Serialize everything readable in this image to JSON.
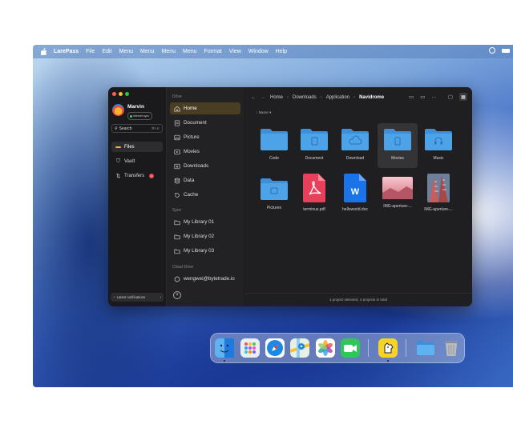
{
  "menubar": {
    "app": "LarePass",
    "items": [
      "File",
      "Edit",
      "Menu",
      "Menu",
      "Menu",
      "Menu",
      "Format",
      "View",
      "Window",
      "Help"
    ]
  },
  "user": {
    "name": "Marvin",
    "status": "Internet sync"
  },
  "search": {
    "placeholder": "Search",
    "shortcut": "⌘+K"
  },
  "sidebar_main": [
    {
      "label": "Files",
      "icon": "folder-icon",
      "active": true
    },
    {
      "label": "Vault",
      "icon": "shield-icon"
    },
    {
      "label": "Transfers",
      "icon": "transfer-icon",
      "badge": "1"
    }
  ],
  "notifications": {
    "label": "Latest notifications"
  },
  "drive": {
    "section": "Drive",
    "items": [
      {
        "label": "Home",
        "icon": "home-icon",
        "active": true
      },
      {
        "label": "Document",
        "icon": "document-icon"
      },
      {
        "label": "Picture",
        "icon": "picture-icon"
      },
      {
        "label": "Movies",
        "icon": "movie-icon"
      },
      {
        "label": "Downloads",
        "icon": "download-icon"
      },
      {
        "label": "Data",
        "icon": "database-icon"
      },
      {
        "label": "Cache",
        "icon": "cache-icon"
      }
    ]
  },
  "sync": {
    "section": "Sync",
    "items": [
      {
        "label": "My Library 01"
      },
      {
        "label": "My Library 02"
      },
      {
        "label": "My Library 03"
      }
    ]
  },
  "cloud": {
    "section": "Cloud Drive",
    "account": "wengwei@bytetrade.io"
  },
  "breadcrumb": [
    "Home",
    "Downloads",
    "Application",
    "Navidrome"
  ],
  "sort": {
    "label": "Name"
  },
  "files": [
    {
      "name": "Code",
      "kind": "folder",
      "icon": "folder-icon"
    },
    {
      "name": "Document",
      "kind": "folder",
      "icon": "document-folder-icon"
    },
    {
      "name": "Download",
      "kind": "folder",
      "icon": "cloud-folder-icon"
    },
    {
      "name": "Movies",
      "kind": "folder",
      "icon": "movie-folder-icon",
      "selected": true
    },
    {
      "name": "Music",
      "kind": "folder",
      "icon": "music-folder-icon"
    },
    {
      "name": "Pictures",
      "kind": "folder",
      "icon": "picture-folder-icon"
    },
    {
      "name": "terminus.pdf",
      "kind": "pdf",
      "icon": "pdf-file-icon"
    },
    {
      "name": "helloworld.doc",
      "kind": "doc",
      "icon": "word-file-icon"
    },
    {
      "name": "IMG-aperture-...",
      "kind": "image",
      "icon": "image-thumbnail-pink"
    },
    {
      "name": "IMG-aperture-...",
      "kind": "image",
      "icon": "image-thumbnail-building"
    }
  ],
  "status": "1 project selected, 4 projects in total",
  "dock": [
    "Finder",
    "Launchpad",
    "Safari",
    "Maps",
    "Photos",
    "FaceTime",
    "LarePass",
    "Downloads",
    "Trash"
  ],
  "colors": {
    "accent": "#4a3e22",
    "folder": "#4da3e8",
    "pdf": "#e8405b",
    "doc": "#1a73e8",
    "badge": "#e5484d"
  }
}
